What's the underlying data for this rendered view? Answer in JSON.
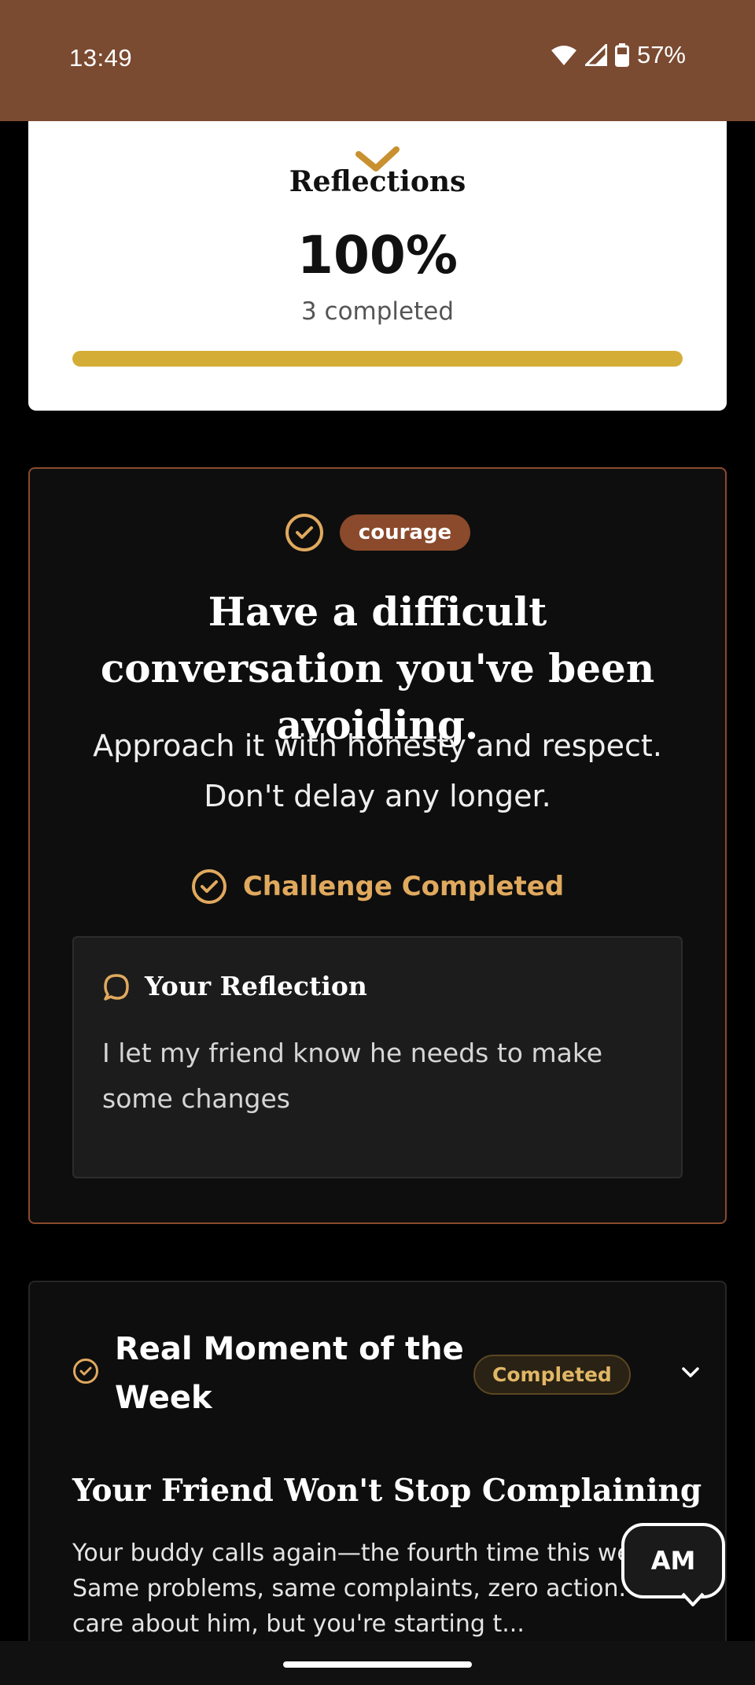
{
  "status_bar": {
    "time": "13:49",
    "battery": "57%"
  },
  "progress_card": {
    "title": "Reflections",
    "percent_text": "100%",
    "subtitle": "3 completed",
    "progress": 1.0,
    "accent": "#d4ad37"
  },
  "challenge": {
    "tag": "courage",
    "title": "Have a difficult conversation you've been avoiding.",
    "description": "Approach it with honesty and respect. Don't delay any longer.",
    "status": "Challenge Completed",
    "reflection": {
      "heading": "Your Reflection",
      "text": "I let my friend know he needs to make some changes"
    }
  },
  "weekly": {
    "title": "Real Moment of the Week",
    "badge": "Completed",
    "story_title": "Your Friend Won't Stop Complaining",
    "story_text": "Your buddy calls again—the fourth time this week. Same problems, same complaints, zero action. You care about him, but you're starting t..."
  },
  "assistant_button": {
    "label": "AM"
  },
  "colors": {
    "status_bar": "#7a4a31",
    "tag_bg": "#8b4a2b",
    "gold": "#e0a95e",
    "card_border": "#8a4a2e"
  }
}
